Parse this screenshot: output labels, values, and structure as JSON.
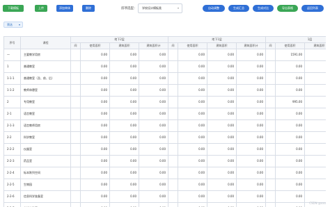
{
  "toolbar": {
    "buttons_left": [
      {
        "label": "下载模板",
        "color": "green"
      },
      {
        "label": "上传",
        "color": "green"
      },
      {
        "label": "添加单体",
        "color": "blue"
      },
      {
        "label": "删除",
        "color": "blue"
      }
    ],
    "scheme_label": "房项选型：",
    "scheme_value": "学校设计模板类",
    "buttons_right": [
      {
        "label": "自动调整",
        "color": "blue"
      },
      {
        "label": "生成汇总",
        "color": "blue"
      },
      {
        "label": "生成对比",
        "color": "blue"
      },
      {
        "label": "导出表格",
        "color": "green"
      },
      {
        "label": "返回列表",
        "color": "blue"
      }
    ]
  },
  "filter": {
    "label": "筛选"
  },
  "table": {
    "col_no": "序号",
    "col_name": "课程",
    "groups": [
      "地下2层",
      "地下1层",
      "1层"
    ],
    "sub_headers": [
      "间",
      "使用面积",
      "建筑面积",
      "建筑面积计"
    ],
    "rows": [
      {
        "no": "一",
        "name": "主要教学用房",
        "values": [
          [
            "",
            "0.00",
            "0.00",
            "0.00"
          ],
          [
            "",
            "0.00",
            "0.00",
            "0.00"
          ],
          [
            "",
            "1591.00",
            "",
            "2091.83"
          ]
        ]
      },
      {
        "no": "1",
        "name": "普通教室",
        "values": [
          [
            "",
            "0.00",
            "0.00",
            "0.00"
          ],
          [
            "",
            "0.00",
            "0.00",
            "0.00"
          ],
          [
            "",
            "0.00",
            "",
            "0.00"
          ]
        ]
      },
      {
        "no": "1-1-1",
        "name": "普通教室（及、前、后）",
        "values": [
          [
            "",
            "0.00",
            "0.00",
            "0.00"
          ],
          [
            "",
            "0.00",
            "0.00",
            "0.00"
          ],
          [
            "",
            "0.00",
            "",
            "0.00"
          ]
        ]
      },
      {
        "no": "1-1-2",
        "name": "教师休憩室",
        "values": [
          [
            "",
            "0.00",
            "0.00",
            "0.00"
          ],
          [
            "",
            "0.00",
            "0.00",
            "0.00"
          ],
          [
            "",
            "0.00",
            "",
            "0.00"
          ]
        ]
      },
      {
        "no": "2",
        "name": "专用教室",
        "values": [
          [
            "",
            "0.00",
            "0.00",
            "0.00"
          ],
          [
            "",
            "0.00",
            "0.00",
            "0.00"
          ],
          [
            "",
            "995.00",
            "",
            "1772.74"
          ]
        ]
      },
      {
        "no": "2-1",
        "name": "语言教室",
        "values": [
          [
            "",
            "0.00",
            "0.00",
            "0.00"
          ],
          [
            "",
            "0.00",
            "0.00",
            "0.00"
          ],
          [
            "",
            "0.00",
            "",
            "0.00"
          ]
        ]
      },
      {
        "no": "2-1-3",
        "name": "语言教师用房",
        "values": [
          [
            "",
            "0.00",
            "0.00",
            "0.00"
          ],
          [
            "",
            "0.00",
            "0.00",
            "0.00"
          ],
          [
            "",
            "0.00",
            "",
            "0.00"
          ]
        ]
      },
      {
        "no": "2-2",
        "name": "科学教室",
        "values": [
          [
            "",
            "0.00",
            "0.00",
            "0.00"
          ],
          [
            "",
            "0.00",
            "0.00",
            "0.00"
          ],
          [
            "",
            "0.00",
            "",
            "0.00"
          ]
        ]
      },
      {
        "no": "2-2-2",
        "name": "仪器室",
        "values": [
          [
            "",
            "0.00",
            "0.00",
            "0.00"
          ],
          [
            "",
            "0.00",
            "0.00",
            "0.00"
          ],
          [
            "",
            "0.00",
            "",
            "0.00"
          ]
        ]
      },
      {
        "no": "2-2-3",
        "name": "药品室",
        "values": [
          [
            "",
            "0.00",
            "0.00",
            "0.00"
          ],
          [
            "",
            "0.00",
            "0.00",
            "0.00"
          ],
          [
            "",
            "0.00",
            "",
            "0.00"
          ]
        ]
      },
      {
        "no": "2-2-4",
        "name": "标本陈列空间",
        "values": [
          [
            "",
            "0.00",
            "0.00",
            "0.00"
          ],
          [
            "",
            "0.00",
            "0.00",
            "0.00"
          ],
          [
            "",
            "0.00",
            "",
            "0.00"
          ]
        ]
      },
      {
        "no": "2-2-5",
        "name": "生物园",
        "values": [
          [
            "",
            "0.00",
            "0.00",
            "0.00"
          ],
          [
            "",
            "0.00",
            "0.00",
            "0.00"
          ],
          [
            "",
            "0.00",
            "",
            "0.00"
          ]
        ]
      },
      {
        "no": "2-2-6",
        "name": "信息科学准备室",
        "values": [
          [
            "",
            "0.00",
            "0.00",
            "0.00"
          ],
          [
            "",
            "0.00",
            "0.00",
            "0.00"
          ],
          [
            "",
            "0.00",
            "",
            "0.00"
          ]
        ]
      },
      {
        "no": "2-2-7",
        "name": "创新实验室",
        "values": [
          [
            "",
            "0.00",
            "0.00",
            "0.00"
          ],
          [
            "",
            "0.00",
            "0.00",
            "0.00"
          ],
          [
            "",
            "0.00",
            "",
            "0.00"
          ]
        ]
      }
    ]
  },
  "watermark": "CSDN @xxx"
}
